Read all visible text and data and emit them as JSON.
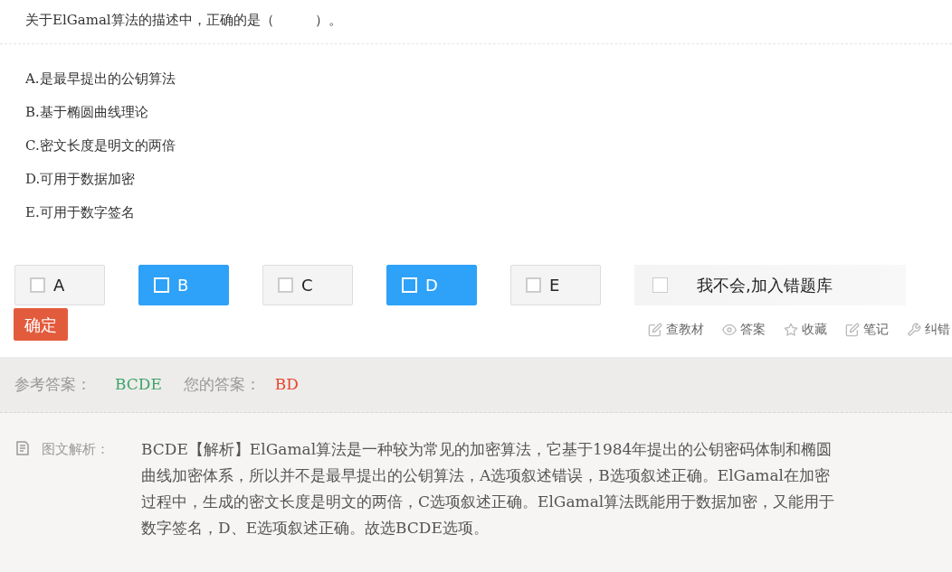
{
  "question": "关于ElGamal算法的描述中，正确的是（　　　）。",
  "options": [
    "A.是最早提出的公钥算法",
    "B.基于椭圆曲线理论",
    "C.密文长度是明文的两倍",
    "D.可用于数据加密",
    "E.可用于数字签名"
  ],
  "choices": [
    {
      "label": "A",
      "selected": false
    },
    {
      "label": "B",
      "selected": true
    },
    {
      "label": "C",
      "selected": false
    },
    {
      "label": "D",
      "selected": true
    },
    {
      "label": "E",
      "selected": false
    }
  ],
  "mistake_toggle": {
    "label": "我不会,加入错题库",
    "checked": false
  },
  "confirm_button": "确定",
  "tools": [
    {
      "kind": "book",
      "label": "查教材"
    },
    {
      "kind": "eye",
      "label": "答案"
    },
    {
      "kind": "star",
      "label": "收藏"
    },
    {
      "kind": "note",
      "label": "笔记"
    },
    {
      "kind": "wrench",
      "label": "纠错"
    }
  ],
  "answers": {
    "reference_label": "参考答案：",
    "reference": "BCDE",
    "yours_label": "您的答案：",
    "yours": "BD"
  },
  "analysis": {
    "label": "图文解析：",
    "text": "BCDE【解析】ElGamal算法是一种较为常见的加密算法，它基于1984年提出的公钥密码体制和椭圆曲线加密体系，所以并不是最早提出的公钥算法，A选项叙述错误，B选项叙述正确。ElGamal在加密过程中，生成的密文长度是明文的两倍，C选项叙述正确。ElGamal算法既能用于数据加密，又能用于数字签名，D、E选项叙述正确。故选BCDE选项。"
  }
}
